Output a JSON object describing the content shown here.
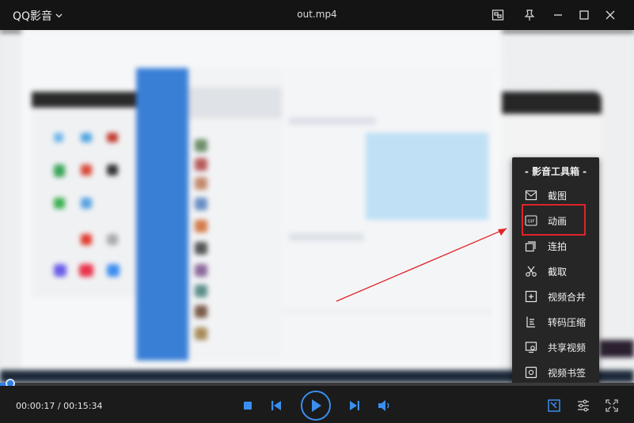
{
  "app": {
    "name": "QQ影音",
    "file_title": "out.mp4"
  },
  "toolbox": {
    "title": "- 影音工具箱 -",
    "items": [
      {
        "label": "截图",
        "icon": "screenshot-icon"
      },
      {
        "label": "动画",
        "icon": "gif-icon",
        "highlighted": true
      },
      {
        "label": "连拍",
        "icon": "burst-icon"
      },
      {
        "label": "截取",
        "icon": "scissors-icon"
      },
      {
        "label": "视频合并",
        "icon": "merge-icon"
      },
      {
        "label": "转码压缩",
        "icon": "transcode-icon"
      },
      {
        "label": "共享视频",
        "icon": "share-icon"
      },
      {
        "label": "视频书签",
        "icon": "bookmark-icon"
      }
    ]
  },
  "player": {
    "time": "00:00:17 / 00:15:34",
    "progress": 0.018
  },
  "colors": {
    "accent": "#2f7fe6",
    "highlight": "#e0232a",
    "menu_bg": "#262626"
  }
}
